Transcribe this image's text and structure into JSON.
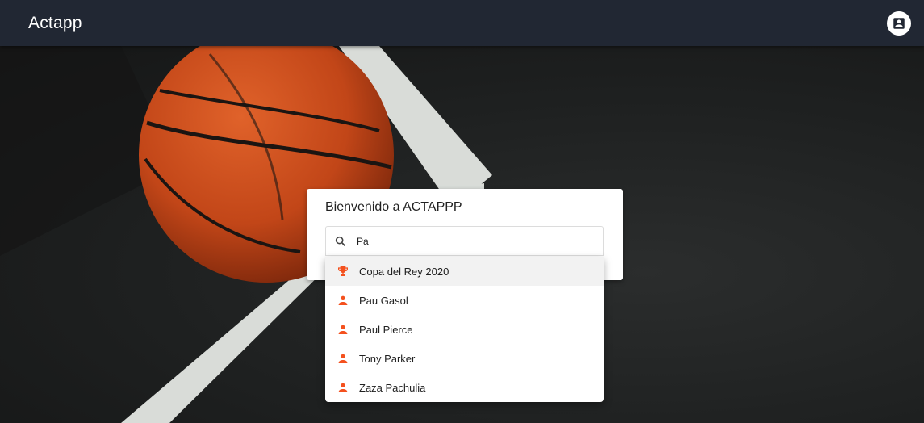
{
  "app": {
    "title": "Actapp"
  },
  "header": {
    "account_icon": "account-box-icon"
  },
  "card": {
    "title": "Bienvenido a ACTAPPP"
  },
  "search": {
    "value": "Pa",
    "icon": "search-icon"
  },
  "suggestions": [
    {
      "label": "Copa del Rey 2020",
      "icon": "trophy-icon",
      "type": "competition"
    },
    {
      "label": "Pau Gasol",
      "icon": "person-icon",
      "type": "player"
    },
    {
      "label": "Paul Pierce",
      "icon": "person-icon",
      "type": "player"
    },
    {
      "label": "Tony Parker",
      "icon": "person-icon",
      "type": "player"
    },
    {
      "label": "Zaza Pachulia",
      "icon": "person-icon",
      "type": "player"
    }
  ],
  "colors": {
    "toolbar": "#212733",
    "accent": "#f4511e",
    "court_line": "#d9dcd8",
    "ball": "#c84a1c"
  }
}
